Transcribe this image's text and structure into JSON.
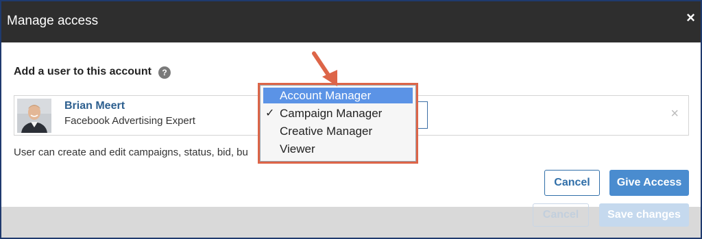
{
  "modal": {
    "title": "Manage access",
    "close_label": "×"
  },
  "add_user": {
    "label": "Add a user to this account",
    "help_label": "?"
  },
  "user": {
    "name": "Brian Meert",
    "title": "Facebook Advertising Expert",
    "remove_label": "×"
  },
  "role_dropdown": {
    "options": [
      {
        "label": "Account Manager",
        "highlighted": true,
        "selected": false
      },
      {
        "label": "Campaign Manager",
        "highlighted": false,
        "selected": true
      },
      {
        "label": "Creative Manager",
        "highlighted": false,
        "selected": false
      },
      {
        "label": "Viewer",
        "highlighted": false,
        "selected": false
      }
    ],
    "check_mark": "✓"
  },
  "permission_description": "User can create and edit campaigns, status, bid, bu",
  "buttons": {
    "cancel": "Cancel",
    "give_access": "Give Access"
  },
  "underlying": {
    "cancel": "Cancel",
    "save": "Save changes"
  },
  "colors": {
    "accent": "#4a8ccf",
    "highlight": "#5b93e6",
    "annotation": "#dd6548",
    "header": "#2e2e2e"
  }
}
